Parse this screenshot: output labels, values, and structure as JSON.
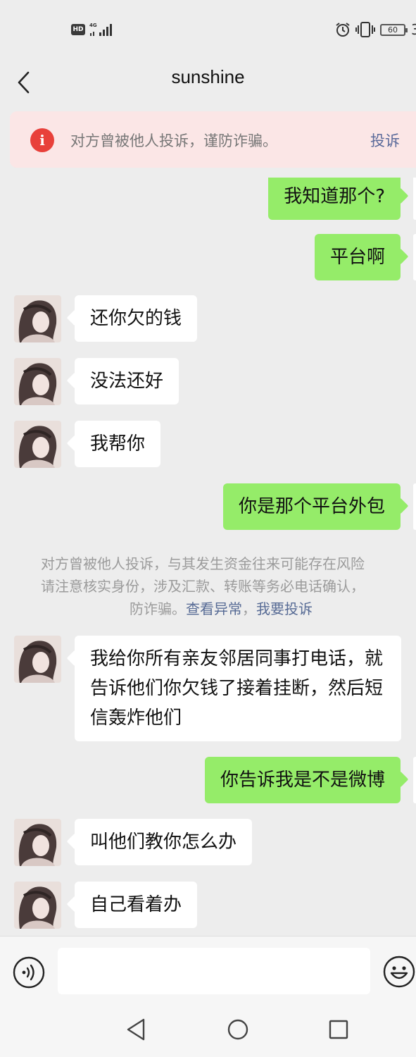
{
  "status_bar": {
    "hd": "HD",
    "network": "4G",
    "battery": "60",
    "clock_partial": "3"
  },
  "header": {
    "title": "sunshine"
  },
  "warning": {
    "text": "对方曾被他人投诉，谨防诈骗。",
    "action": "投诉"
  },
  "messages": [
    {
      "side": "out",
      "text": "我知道那个?"
    },
    {
      "side": "out",
      "text": "平台啊"
    },
    {
      "side": "in",
      "text": "还你欠的钱"
    },
    {
      "side": "in",
      "text": "没法还好"
    },
    {
      "side": "in",
      "text": "我帮你"
    },
    {
      "side": "out",
      "text": "你是那个平台外包"
    },
    {
      "side": "in",
      "text": "我给你所有亲友邻居同事打电话，就告诉他们你欠钱了接着挂断，然后短信轰炸他们"
    },
    {
      "side": "out",
      "text": "你告诉我是不是微博"
    },
    {
      "side": "in",
      "text": "叫他们教你怎么办"
    },
    {
      "side": "in",
      "text": "自己看着办"
    }
  ],
  "system_notice": {
    "line1": "对方曾被他人投诉，与其发生资金往来可能存在风险",
    "line2": "请注意核实身份，涉及汇款、转账等务必电话确认，",
    "line3_prefix": "防诈骗。",
    "link_view": "查看异常",
    "separator": "，",
    "link_report": "我要投诉"
  },
  "input_bar": {
    "placeholder": ""
  },
  "colors": {
    "bubble_out": "#95ec69",
    "bubble_in": "#ffffff",
    "warning_bg": "#fbe6e6",
    "warning_icon": "#e8403a",
    "link": "#576b95"
  }
}
